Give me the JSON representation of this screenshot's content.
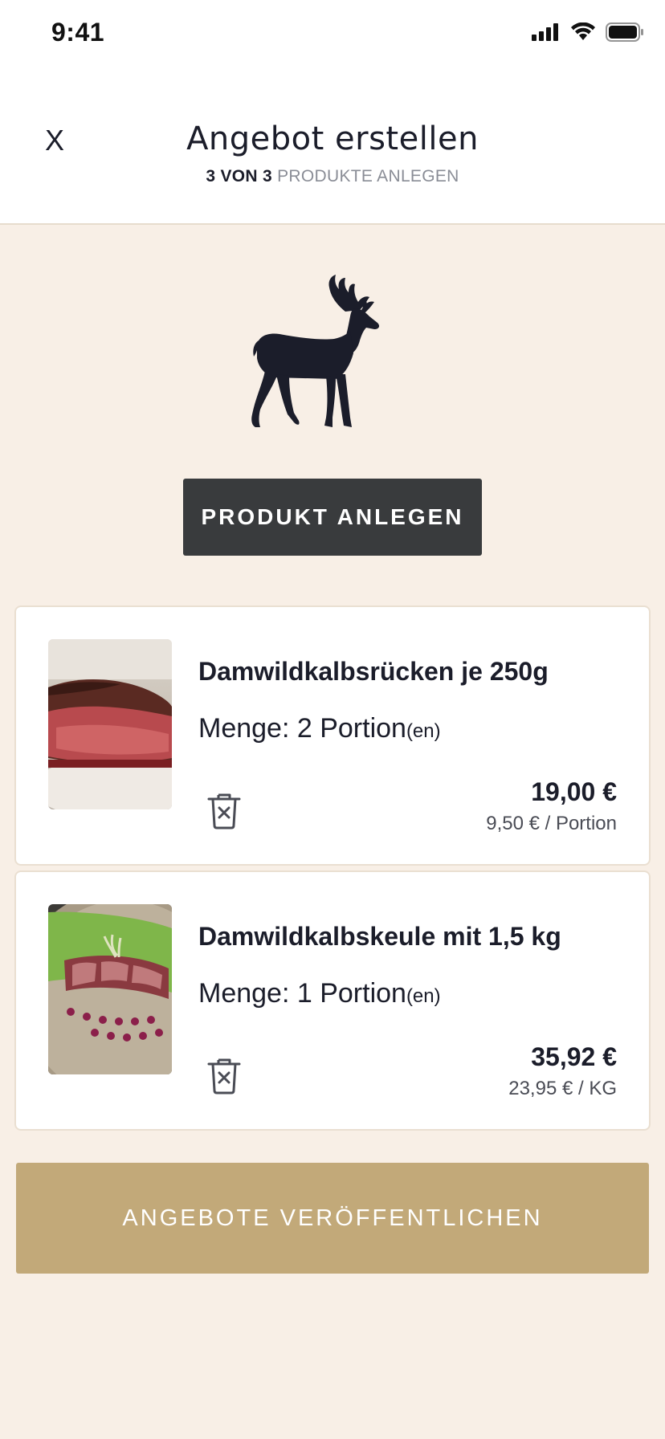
{
  "status_bar": {
    "time": "9:41"
  },
  "header": {
    "close_label": "X",
    "title": "Angebot erstellen",
    "step_strong": "3 VON 3",
    "step_muted": "PRODUKTE ANLEGEN"
  },
  "add_product_button": "PRODUKT ANLEGEN",
  "products": [
    {
      "title": "Damwildkalbsrücken je 250g",
      "quantity": "Menge: 2 Portion",
      "quantity_suffix": "(en)",
      "price": "19,00 €",
      "unit_price": "9,50 € / Portion"
    },
    {
      "title": "Damwildkalbskeule mit 1,5 kg",
      "quantity": "Menge: 1 Portion",
      "quantity_suffix": "(en)",
      "price": "35,92 €",
      "unit_price": "23,95 € / KG"
    }
  ],
  "publish_button": "ANGEBOTE VERÖFFENTLICHEN",
  "colors": {
    "background": "#f8efe6",
    "dark_button": "#393b3d",
    "gold_button": "#c2a979",
    "text_dark": "#1b1d2a"
  }
}
